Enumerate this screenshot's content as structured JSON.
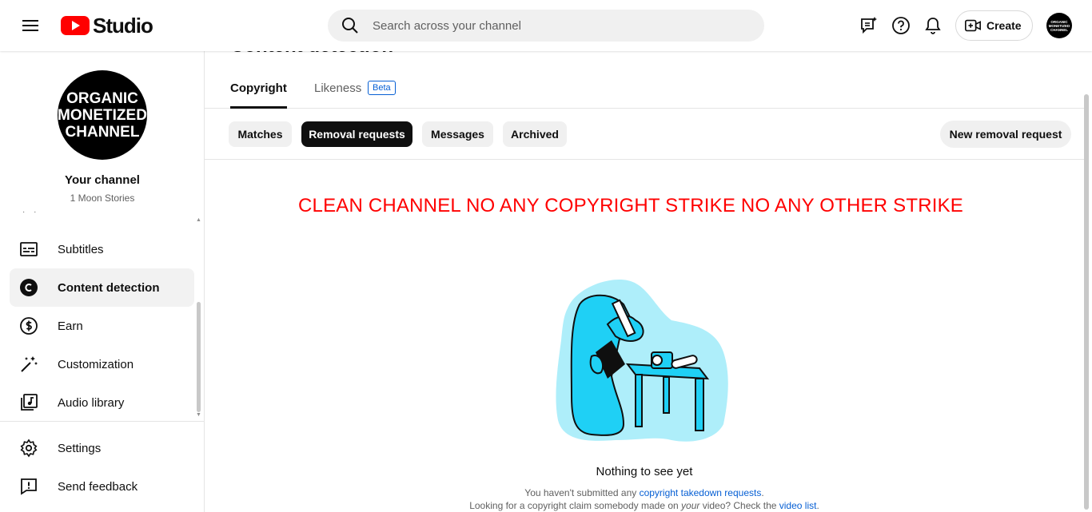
{
  "topbar": {
    "logo_text": "Studio",
    "search_placeholder": "Search across your channel",
    "create_label": "Create",
    "avatar_lines": [
      "ORGANIC",
      "MONETIZED",
      "CHANNEL"
    ]
  },
  "sidebar": {
    "avatar_lines": [
      "ORGANIC",
      "MONETIZED",
      "CHANNEL"
    ],
    "channel_title": "Your channel",
    "channel_name": "1 Moon Stories",
    "items": [
      {
        "label": "Subtitles",
        "icon": "subtitles-icon"
      },
      {
        "label": "Content detection",
        "icon": "content-detection-icon",
        "active": true
      },
      {
        "label": "Earn",
        "icon": "dollar-icon"
      },
      {
        "label": "Customization",
        "icon": "magic-wand-icon"
      },
      {
        "label": "Audio library",
        "icon": "audio-library-icon"
      },
      {
        "label": "Settings",
        "icon": "gear-icon"
      },
      {
        "label": "Send feedback",
        "icon": "feedback-icon"
      }
    ]
  },
  "main": {
    "page_title": "Content detection",
    "tabs": [
      {
        "label": "Copyright",
        "active": true
      },
      {
        "label": "Likeness",
        "badge": "Beta"
      }
    ],
    "chips": [
      {
        "label": "Matches"
      },
      {
        "label": "Removal requests",
        "active": true
      },
      {
        "label": "Messages"
      },
      {
        "label": "Archived"
      }
    ],
    "new_request_label": "New removal request",
    "banner": "CLEAN CHANNEL NO ANY COPYRIGHT STRIKE NO ANY OTHER STRIKE",
    "empty": {
      "title": "Nothing to see yet",
      "line1_pre": "You haven't submitted any ",
      "line1_link": "copyright takedown requests",
      "line1_post": ".",
      "line2_pre": "Looking for a copyright claim somebody made on ",
      "line2_em": "your",
      "line2_mid": " video? Check the ",
      "line2_link": "video list",
      "line2_post": "."
    }
  },
  "colors": {
    "brand_red": "#ff0000",
    "link_blue": "#065fd4",
    "illustration_cyan": "#1fd0f5"
  }
}
